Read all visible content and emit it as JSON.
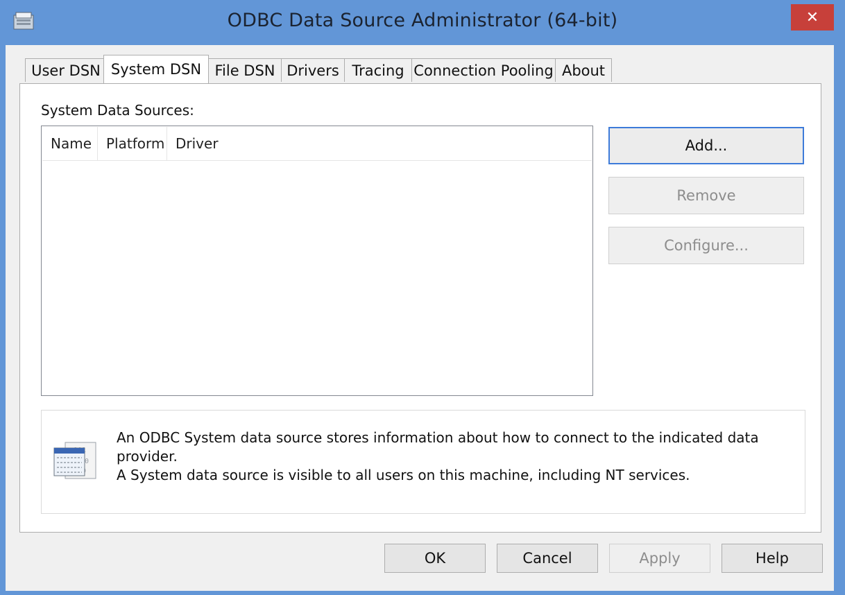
{
  "window": {
    "title": "ODBC Data Source Administrator (64-bit)",
    "close_label": "✕"
  },
  "tabs": [
    {
      "label": "User DSN"
    },
    {
      "label": "System DSN",
      "active": true
    },
    {
      "label": "File DSN"
    },
    {
      "label": "Drivers"
    },
    {
      "label": "Tracing"
    },
    {
      "label": "Connection Pooling"
    },
    {
      "label": "About"
    }
  ],
  "panel": {
    "sources_label": "System Data Sources:",
    "columns": [
      "Name",
      "Platform",
      "Driver"
    ],
    "rows": [],
    "buttons": {
      "add": "Add...",
      "remove": "Remove",
      "configure": "Configure..."
    },
    "info_lines": [
      "An ODBC System data source stores information about how to connect to the indicated data provider.",
      "A System data source is visible to all users on this machine, including NT services."
    ]
  },
  "footer": {
    "ok": "OK",
    "cancel": "Cancel",
    "apply": "Apply",
    "help": "Help"
  },
  "colors": {
    "title_bar": "#6296d7",
    "close_button": "#c7403a",
    "default_button_border": "#3d7bd9"
  },
  "icons": {
    "app": "odbc-app-icon",
    "info": "data-table-icon",
    "close": "close-icon"
  }
}
